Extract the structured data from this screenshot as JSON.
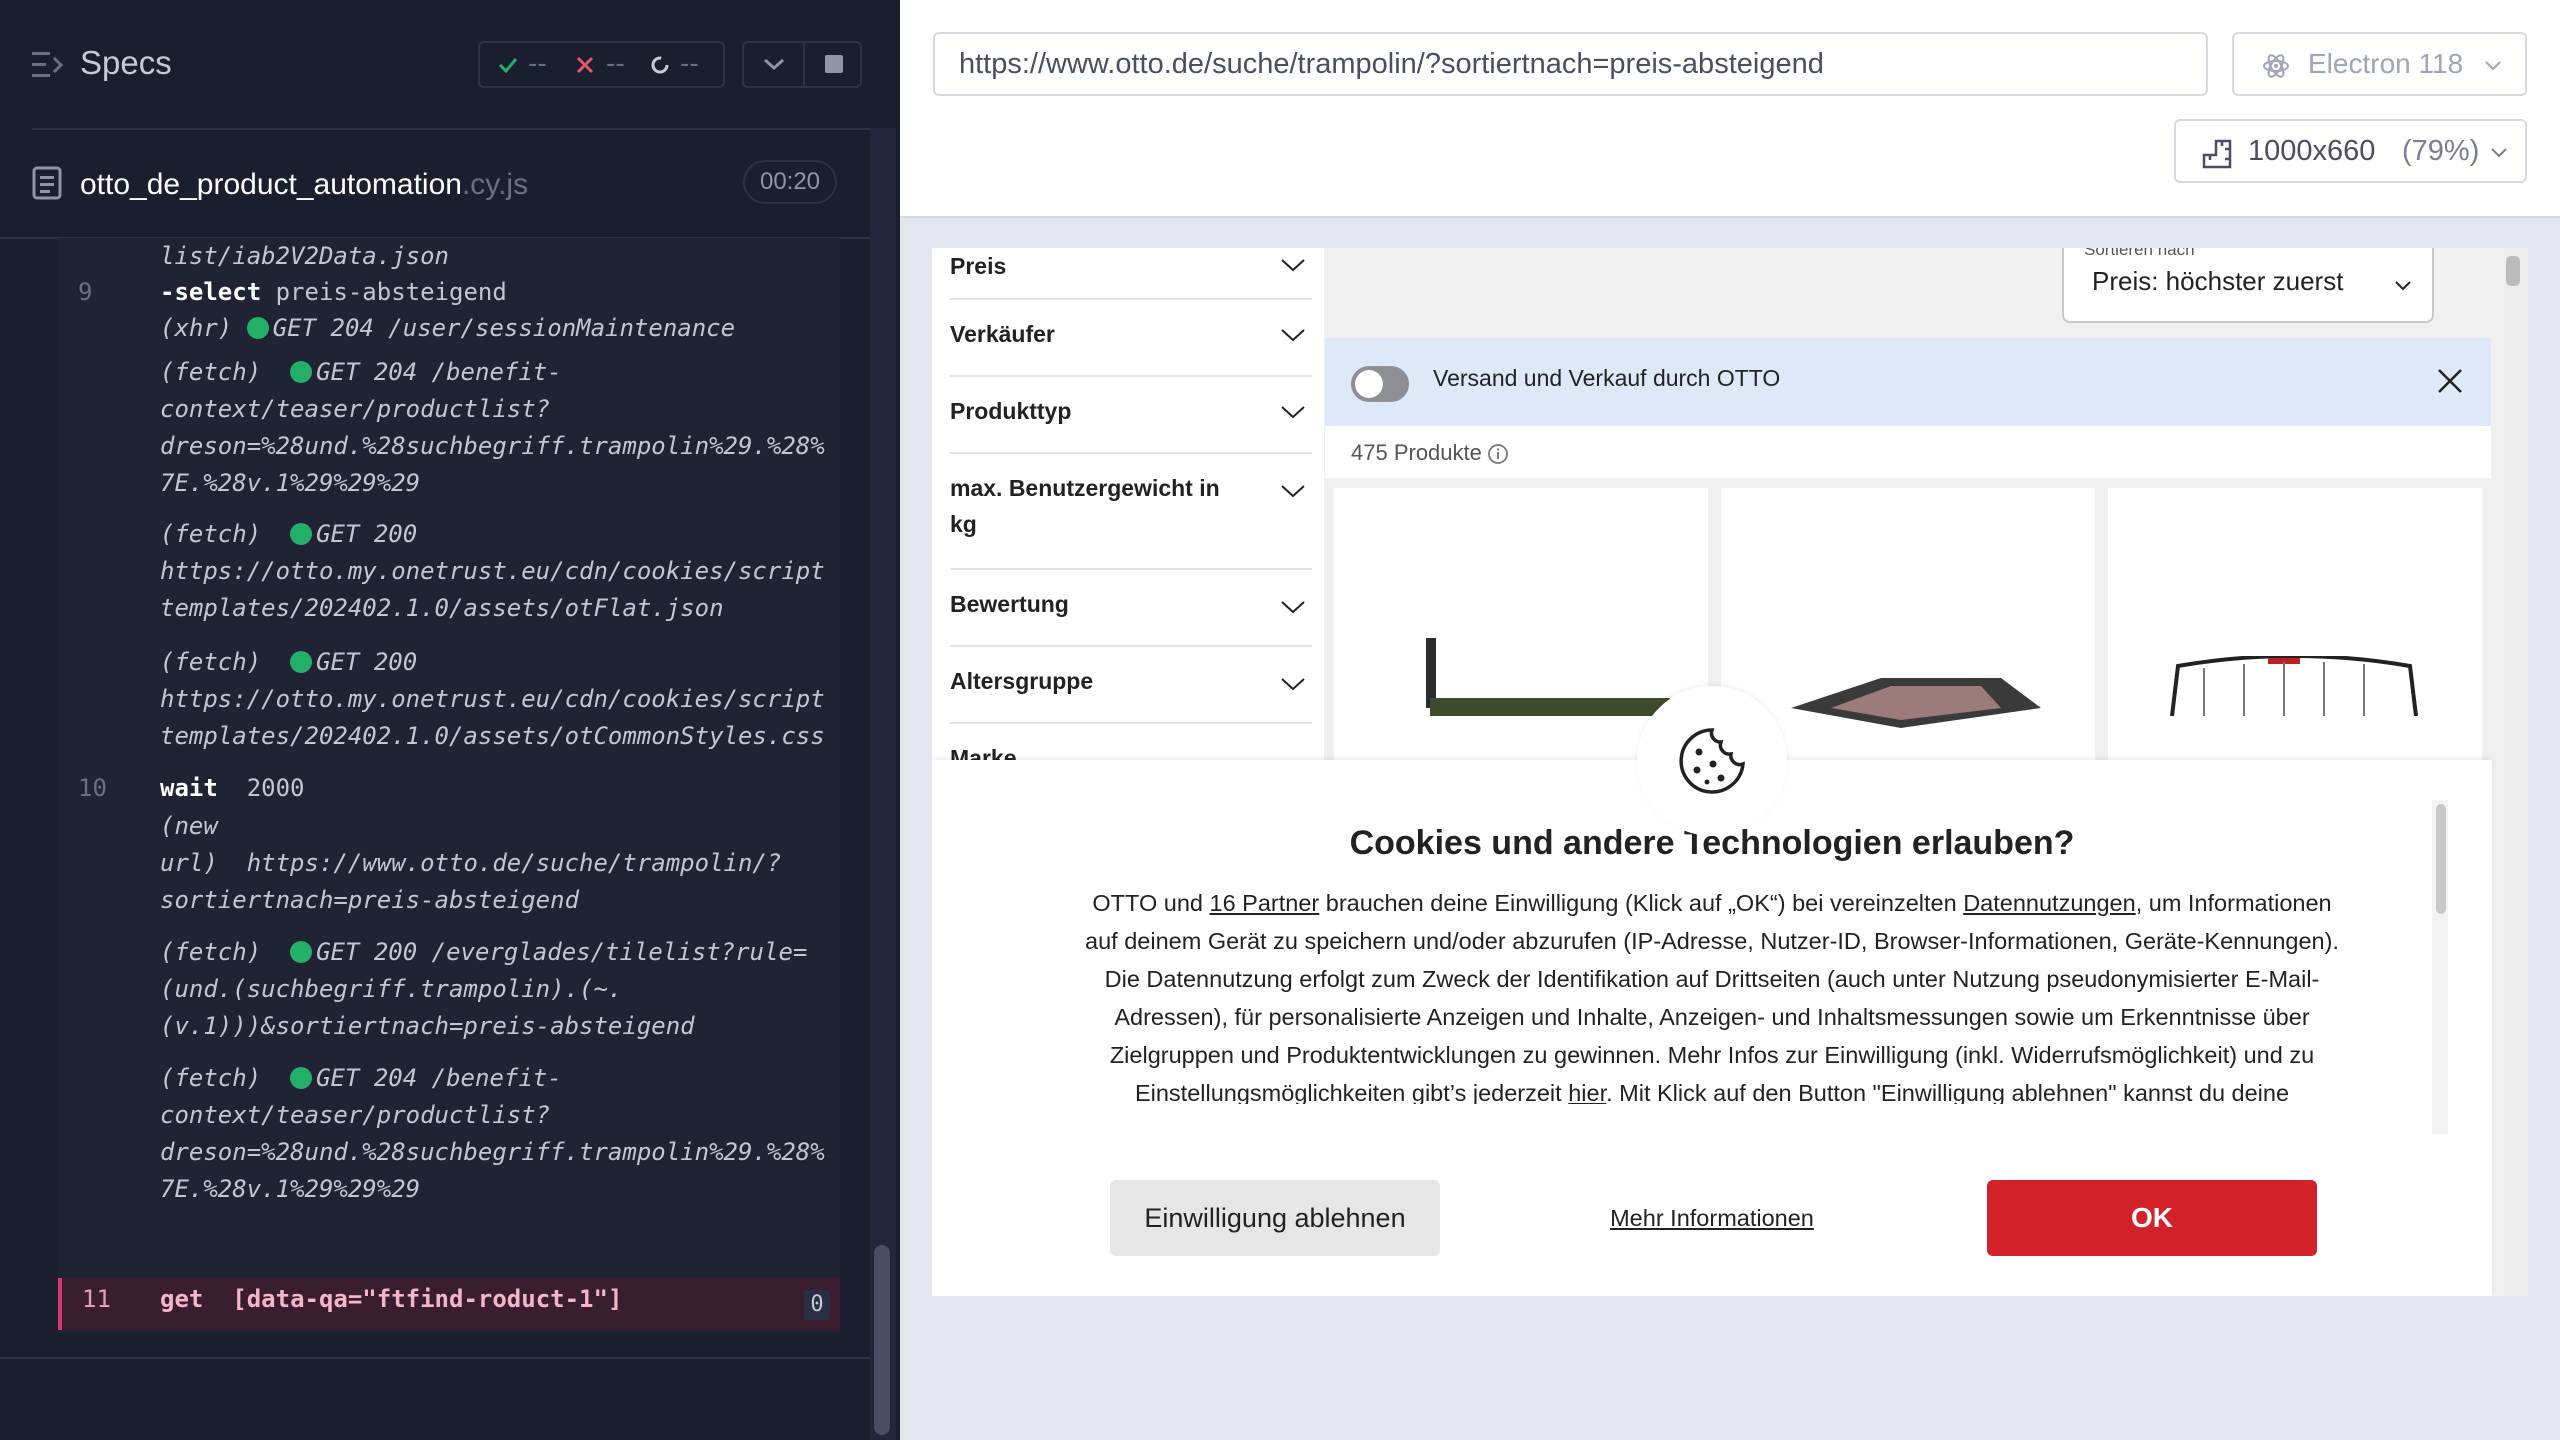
{
  "header": {
    "title": "Specs",
    "passed": "--",
    "failed": "--",
    "pending": "--"
  },
  "file": {
    "name": "otto_de_product_automation",
    "ext": ".cy.js",
    "duration": "00:20"
  },
  "commands": {
    "c0": "list/iab2V2Data.json",
    "c1_num": "9",
    "c1_name": "-select",
    "c1_arg": "preis-absteigend",
    "c2_type": "(xhr)",
    "c2_msg": "GET 204 /user/sessionMaintenance",
    "c3_type": "(fetch)",
    "c3_msg1": "GET 204 /benefit-",
    "c3_msg2": "context/teaser/productlist?",
    "c3_msg3": "dreson=%28und.%28suchbegriff.trampolin%29.%28%",
    "c3_msg4": "7E.%28v.1%29%29%29",
    "c4_type": "(fetch)",
    "c4_msg1": "GET 200",
    "c4_msg2": "https://otto.my.onetrust.eu/cdn/cookies/script",
    "c4_msg3": "templates/202402.1.0/assets/otFlat.json",
    "c5_type": "(fetch)",
    "c5_msg1": "GET 200",
    "c5_msg2": "https://otto.my.onetrust.eu/cdn/cookies/script",
    "c5_msg3": "templates/202402.1.0/assets/otCommonStyles.css",
    "c6_num": "10",
    "c6_name": "wait",
    "c6_arg": "2000",
    "c7_l1": "(new",
    "c7_l2a": "url)",
    "c7_l2b": "https://www.otto.de/suche/trampolin/?",
    "c7_l3": "sortiertnach=preis-absteigend",
    "c8_type": "(fetch)",
    "c8_msg1": "GET 200 /everglades/tilelist?rule=",
    "c8_msg2": "(und.(suchbegriff.trampolin).(~.",
    "c8_msg3": "(v.1)))&sortiertnach=preis-absteigend",
    "c9_type": "(fetch)",
    "c9_msg1": "GET 204 /benefit-",
    "c9_msg2": "context/teaser/productlist?",
    "c9_msg3": "dreson=%28und.%28suchbegriff.trampolin%29.%28%",
    "c9_msg4": "7E.%28v.1%29%29%29",
    "active_num": "11",
    "active_name": "get",
    "active_arg": "[data-qa=\"ftfind-roduct-1\"]",
    "active_badge": "0"
  },
  "browser": {
    "url": "https://www.otto.de/suche/trampolin/?sortiertnach=preis-absteigend",
    "name": "Electron 118",
    "viewport": "1000x660",
    "scale": "(79%)"
  },
  "aut": {
    "filters": [
      "Preis",
      "Verkäufer",
      "Produkttyp",
      "max. Benutzergewicht in kg",
      "Bewertung",
      "Altersgruppe",
      "Marke"
    ],
    "sort_label": "Sortieren nach",
    "sort_value": "Preis: höchster zuerst",
    "banner_text": "Versand und Verkauf durch OTTO",
    "product_count": "475 Produkte",
    "cookie_title": "Cookies und andere Technologien erlauben?",
    "cookie_p1": "OTTO und ",
    "cookie_partner": "16 Partner",
    "cookie_p2": " brauchen deine Einwilligung (Klick auf „OK“) bei vereinzelten ",
    "cookie_datennutzungen": "Datennutzungen",
    "cookie_p3": ", um Informationen auf deinem Gerät zu speichern und/oder abzurufen (IP-Adresse, Nutzer-ID, Browser-Informationen, Geräte-Kennungen). Die Datennutzung erfolgt zum Zweck der Identifikation auf Drittseiten (auch unter Nutzung pseudonymisierter E-Mail-Adressen), für personalisierte Anzeigen und Inhalte, Anzeigen- und Inhaltsmessungen sowie um Erkenntnisse über Zielgruppen und Produktentwicklungen zu gewinnen. Mehr Infos zur Einwilligung (inkl. Widerrufsmöglichkeit) und zu Einstellungsmöglichkeiten gibt’s jederzeit ",
    "cookie_hier": "hier",
    "cookie_p4": ". Mit Klick auf den Button \"Einwilligung ablehnen\" kannst du deine Einwilligung jederzeit ablehnen.",
    "btn_decline": "Einwilligung ablehnen",
    "btn_more": "Mehr Informationen",
    "btn_ok": "OK"
  },
  "colors": {
    "accent_pass": "#25b06a",
    "accent_fail": "#e45770",
    "otto_red": "#d32129",
    "active_cmd_bg": "#3a1e30"
  }
}
